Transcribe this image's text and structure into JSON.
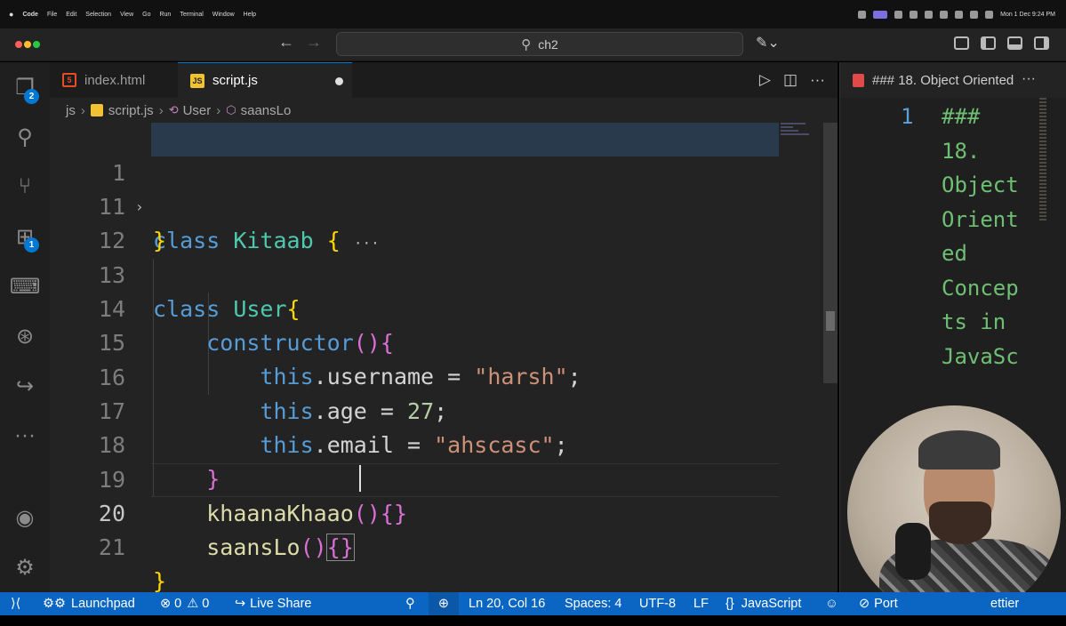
{
  "menubar": {
    "apple": "",
    "items": [
      "Code",
      "File",
      "Edit",
      "Selection",
      "View",
      "Go",
      "Run",
      "Terminal",
      "Window",
      "Help"
    ],
    "clock": "Mon 1 Dec 9:24 PM"
  },
  "titlebar": {
    "search": "ch2",
    "back_icon": "arrow-left-icon",
    "forward_icon": "arrow-right-icon"
  },
  "activity": {
    "explorer_badge": "2",
    "extensions_badge": "1",
    "more": "···"
  },
  "tabs": [
    {
      "label": "index.html",
      "icon": "html5-icon"
    },
    {
      "label": "script.js",
      "icon": "js-icon",
      "dirty": true
    }
  ],
  "breadcrumb": {
    "folder": "js",
    "file": "script.js",
    "class": "User",
    "method": "saansLo"
  },
  "editor": {
    "lines": [
      {
        "n": "1",
        "folded": true,
        "text": "class Kitaab {"
      },
      {
        "n": "11",
        "text": "}"
      },
      {
        "n": "12",
        "text": ""
      },
      {
        "n": "13",
        "text": "class User{"
      },
      {
        "n": "14",
        "text": "constructor(){"
      },
      {
        "n": "15",
        "text": "this.username = \"harsh\";"
      },
      {
        "n": "16",
        "text": "this.age = 27;"
      },
      {
        "n": "17",
        "text": "this.email = \"ahscasc\";"
      },
      {
        "n": "18",
        "text": "}"
      },
      {
        "n": "19",
        "text": "khaanaKhaao(){}"
      },
      {
        "n": "20",
        "text": "saansLo(){}"
      },
      {
        "n": "21",
        "text": "}"
      }
    ],
    "tokens": {
      "class": "class",
      "kitaab": "Kitaab",
      "ellipsis": "···",
      "user": "User",
      "constructor": "constructor",
      "this": "this",
      "username_prop": ".username",
      "username_val": "harsh",
      "age_prop": ".age",
      "age_val": "27",
      "email_prop": ".email",
      "email_val": "ahscasc",
      "method1": "khaanaKhaao",
      "method2": "saansLo",
      "eq": " = ",
      "semi": ";",
      "quote": "\""
    }
  },
  "right_panel": {
    "tab_title": "### 18. Object Oriented",
    "line_number": "1",
    "wrapped_lines": [
      "###",
      "18.",
      "Object",
      "",
      "Orient",
      "ed",
      "Concep",
      "ts in",
      "JavaSc"
    ]
  },
  "statusbar": {
    "launchpad": "Launchpad",
    "errors": "0",
    "warnings": "0",
    "live_share": "Live Share",
    "position": "Ln 20, Col 16",
    "spaces": "Spaces: 4",
    "encoding": "UTF-8",
    "eol": "LF",
    "language": "JavaScript",
    "port": "Port",
    "prettier": "ettier"
  },
  "colors": {
    "statusbar": "#0a66c2",
    "editor_bg": "#232323",
    "keyword": "#569cd6",
    "class_name": "#4ec9b0",
    "function": "#dcdcaa",
    "string": "#ce9178",
    "number": "#b5cea8"
  }
}
